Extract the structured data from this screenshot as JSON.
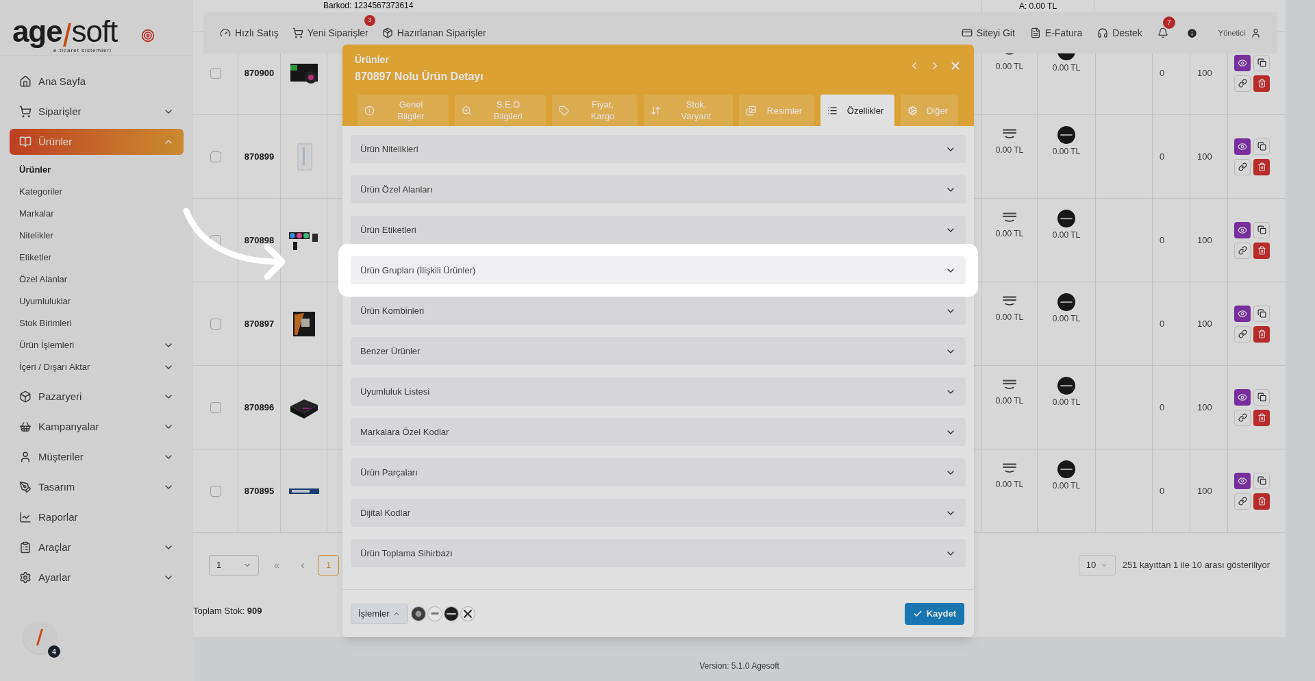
{
  "logo": {
    "text_1": "age",
    "text_2": "soft",
    "tagline": "e-ticaret sistemleri"
  },
  "sidebar": {
    "items": [
      {
        "label": "Ana Sayfa",
        "selected": false
      },
      {
        "label": "Siparişler",
        "selected": false,
        "expanded": false
      },
      {
        "label": "Ürünler",
        "selected": true,
        "expanded": true,
        "children": [
          {
            "label": "Ürünler",
            "selected": true
          },
          {
            "label": "Kategoriler",
            "selected": false
          },
          {
            "label": "Markalar",
            "selected": false
          },
          {
            "label": "Nitelikler",
            "selected": false
          },
          {
            "label": "Etiketler",
            "selected": false
          },
          {
            "label": "Özel Alanlar",
            "selected": false
          },
          {
            "label": "Uyumluluklar",
            "selected": false
          },
          {
            "label": "Stok Birimleri",
            "selected": false
          },
          {
            "label": "Ürün İşlemleri",
            "selected": false,
            "expanded": false
          },
          {
            "label": "İçeri / Dışarı Aktar",
            "selected": false,
            "expanded": false
          }
        ]
      },
      {
        "label": "Pazaryeri",
        "selected": false,
        "expanded": false
      },
      {
        "label": "Kampanyalar",
        "selected": false,
        "expanded": false
      },
      {
        "label": "Müşteriler",
        "selected": false,
        "expanded": false
      },
      {
        "label": "Tasarım",
        "selected": false,
        "expanded": false
      },
      {
        "label": "Raporlar",
        "selected": false
      },
      {
        "label": "Araçlar",
        "selected": false,
        "expanded": false
      },
      {
        "label": "Ayarlar",
        "selected": false,
        "expanded": false
      }
    ]
  },
  "avatar_badge": "4",
  "topbar": {
    "left": [
      {
        "label": "Hızlı Satış"
      },
      {
        "label": "Yeni Siparişler",
        "badge": "3"
      },
      {
        "label": "Hazırlanan Siparişler"
      }
    ],
    "right": [
      {
        "label": "Siteyi Git"
      },
      {
        "label": "E-Fatura"
      },
      {
        "label": "Destek"
      }
    ],
    "notifications_badge": "7",
    "user": "Yönetici"
  },
  "table": {
    "partial_row": {
      "barcode": "Barkod: 1234567373614",
      "price": "A: 0.00 TL"
    },
    "rows": [
      {
        "id": "870900",
        "checked": false,
        "hb_price": "0.00 TL",
        "ty_price": "0.00 TL",
        "col_8": "0",
        "col_9": "100"
      },
      {
        "id": "870899",
        "checked": false,
        "hb_price": "0.00 TL",
        "ty_price": "0.00 TL",
        "col_8": "0",
        "col_9": "100"
      },
      {
        "id": "870898",
        "checked": false,
        "hb_price": "0.00 TL",
        "ty_price": "0.00 TL",
        "col_8": "0",
        "col_9": "100"
      },
      {
        "id": "870897",
        "checked": false,
        "hb_price": "0.00 TL",
        "ty_price": "0.00 TL",
        "col_8": "0",
        "col_9": "100"
      },
      {
        "id": "870896",
        "checked": false,
        "hb_price": "0.00 TL",
        "ty_price": "0.00 TL",
        "col_8": "0",
        "col_9": "100"
      },
      {
        "id": "870895",
        "checked": false,
        "hb_price": "0.00 TL",
        "ty_price": "0.00 TL",
        "col_8": "0",
        "col_9": "100"
      }
    ]
  },
  "pagination": {
    "page_select": "1",
    "first": "«",
    "prev": "‹",
    "pages": [
      {
        "label": "1",
        "selected": true
      }
    ],
    "page_size": "10",
    "summary": "251 kayıttan 1 ile 10 arası gösteriliyor"
  },
  "total_stock": {
    "label": "Toplam Stok:",
    "value": "909"
  },
  "version": "Version: 5.1.0 Agesoft",
  "modal": {
    "subtitle": "Ürünler",
    "title": "870897 Nolu Ürün Detayı",
    "tabs": [
      {
        "label": "Genel\nBilgiler",
        "selected": false
      },
      {
        "label": "S.E.O\nBilgileri",
        "selected": false
      },
      {
        "label": "Fiyat,\nKargo",
        "selected": false
      },
      {
        "label": "Stok,\nVaryant",
        "selected": false
      },
      {
        "label": "Resimler",
        "selected": false
      },
      {
        "label": "Özellikler",
        "selected": true
      },
      {
        "label": "Diğer",
        "selected": false
      }
    ],
    "sections": [
      {
        "label": "Ürün Nitelikleri",
        "expanded": false,
        "highlighted": false
      },
      {
        "label": "Ürün Özel Alanları",
        "expanded": false,
        "highlighted": false
      },
      {
        "label": "Ürün Etiketleri",
        "expanded": false,
        "highlighted": false
      },
      {
        "label": "Ürün Grupları (İlişkili Ürünler)",
        "expanded": false,
        "highlighted": true
      },
      {
        "label": "Ürün Kombinleri",
        "expanded": false,
        "highlighted": false
      },
      {
        "label": "Benzer Ürünler",
        "expanded": false,
        "highlighted": false
      },
      {
        "label": "Uyumluluk Listesi",
        "expanded": false,
        "highlighted": false
      },
      {
        "label": "Markalara Özel Kodlar",
        "expanded": false,
        "highlighted": false
      },
      {
        "label": "Ürün Parçaları",
        "expanded": false,
        "highlighted": false
      },
      {
        "label": "Dijital Kodlar",
        "expanded": false,
        "highlighted": false
      },
      {
        "label": "Ürün Toplama Sihirbazı",
        "expanded": false,
        "highlighted": false
      }
    ],
    "actions_button": "İşlemler",
    "save_button": "Kaydet"
  }
}
